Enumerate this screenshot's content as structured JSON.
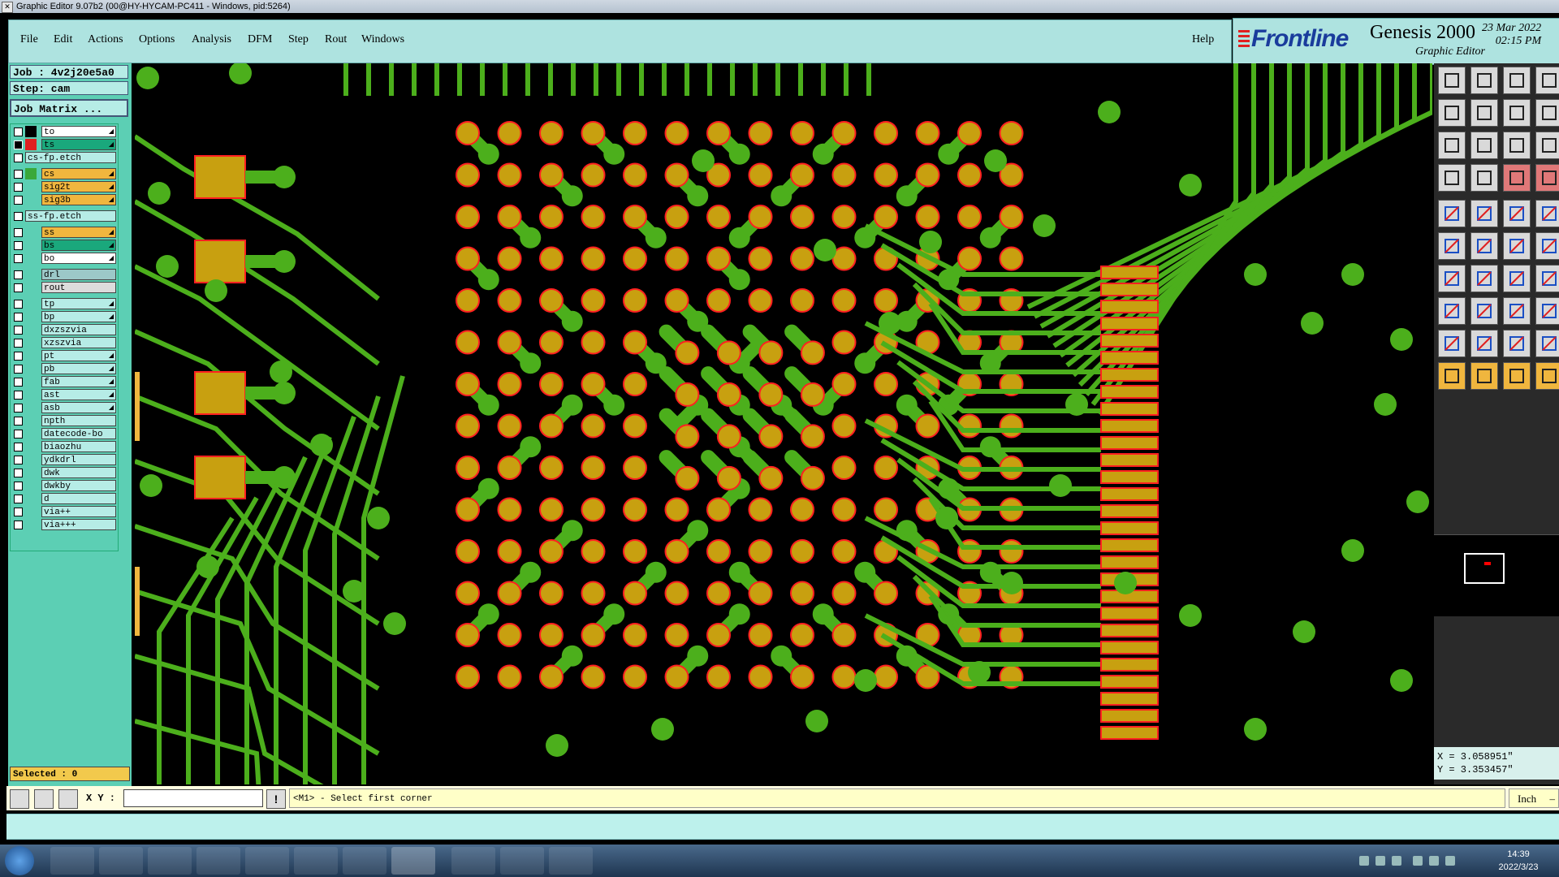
{
  "window": {
    "title": "Graphic Editor 9.07b2 (00@HY-HYCAM-PC411 - Windows, pid:5264)"
  },
  "menu": {
    "items": [
      "File",
      "Edit",
      "Actions",
      "Options",
      "Analysis",
      "DFM",
      "Step",
      "Rout",
      "Windows"
    ],
    "help": "Help"
  },
  "brand": {
    "logo": "Frontline",
    "product": "Genesis 2000",
    "subtitle": "Graphic Editor",
    "date": "23 Mar 2022",
    "time": "02:15 PM"
  },
  "job": {
    "job_label": "Job : 4v2j20e5a0",
    "step_label": "Step: cam",
    "matrix_button": "Job Matrix ..."
  },
  "layers": [
    {
      "name": "to",
      "color": "#ffffff",
      "swatch": "#000000",
      "arrow": true
    },
    {
      "name": "ts",
      "color": "#1aa87c",
      "swatch": "#e02020",
      "arrow": true,
      "active": true
    },
    {
      "name": "cs-fp.etch",
      "color": "#b6ece6",
      "swatch": "",
      "arrow": false,
      "wide": true
    },
    {
      "name": "cs",
      "color": "#f0b63e",
      "swatch": "#3aa83a",
      "arrow": true
    },
    {
      "name": "sig2t",
      "color": "#f0b63e",
      "swatch": "",
      "arrow": true
    },
    {
      "name": "sig3b",
      "color": "#f0b63e",
      "swatch": "",
      "arrow": true
    },
    {
      "name": "ss-fp.etch",
      "color": "#b6ece6",
      "swatch": "",
      "arrow": false,
      "wide": true
    },
    {
      "name": "ss",
      "color": "#f0b63e",
      "swatch": "",
      "arrow": true
    },
    {
      "name": "bs",
      "color": "#1aa87c",
      "swatch": "",
      "arrow": true
    },
    {
      "name": "bo",
      "color": "#ffffff",
      "swatch": "",
      "arrow": true
    },
    {
      "name": "drl",
      "color": "#9cc8c8",
      "swatch": "",
      "arrow": false
    },
    {
      "name": "rout",
      "color": "#dcdcdc",
      "swatch": "",
      "arrow": false
    },
    {
      "name": "tp",
      "color": "#b6ece6",
      "swatch": "",
      "arrow": true
    },
    {
      "name": "bp",
      "color": "#b6ece6",
      "swatch": "",
      "arrow": true
    },
    {
      "name": "dxzszvia",
      "color": "#b6ece6",
      "swatch": "",
      "arrow": false
    },
    {
      "name": "xzszvia",
      "color": "#b6ece6",
      "swatch": "",
      "arrow": false
    },
    {
      "name": "pt",
      "color": "#b6ece6",
      "swatch": "",
      "arrow": true
    },
    {
      "name": "pb",
      "color": "#b6ece6",
      "swatch": "",
      "arrow": true
    },
    {
      "name": "fab",
      "color": "#b6ece6",
      "swatch": "",
      "arrow": true
    },
    {
      "name": "ast",
      "color": "#b6ece6",
      "swatch": "",
      "arrow": true
    },
    {
      "name": "asb",
      "color": "#b6ece6",
      "swatch": "",
      "arrow": true
    },
    {
      "name": "npth",
      "color": "#b6ece6",
      "swatch": "",
      "arrow": false
    },
    {
      "name": "datecode-bo",
      "color": "#b6ece6",
      "swatch": "",
      "arrow": false
    },
    {
      "name": "biaozhu",
      "color": "#b6ece6",
      "swatch": "",
      "arrow": false
    },
    {
      "name": "ydkdrl",
      "color": "#b6ece6",
      "swatch": "",
      "arrow": false
    },
    {
      "name": "dwk",
      "color": "#b6ece6",
      "swatch": "",
      "arrow": false
    },
    {
      "name": "dwkby",
      "color": "#b6ece6",
      "swatch": "",
      "arrow": false
    },
    {
      "name": "d",
      "color": "#b6ece6",
      "swatch": "",
      "arrow": false
    },
    {
      "name": "via++",
      "color": "#b6ece6",
      "swatch": "",
      "arrow": false
    },
    {
      "name": "via+++",
      "color": "#b6ece6",
      "swatch": "",
      "arrow": false
    }
  ],
  "selection": {
    "label": "Selected : 0"
  },
  "coords": {
    "x": "X = 3.058951\"",
    "y": "Y = 3.353457\""
  },
  "command": {
    "xy_label": "X Y :",
    "xy_value": "",
    "warn": "!",
    "prompt": "<M1> - Select first corner",
    "unit": "Inch"
  },
  "taskbar": {
    "time": "14:39",
    "date": "2022/3/23"
  },
  "colors": {
    "trace": "#4caf1c",
    "pad": "#c8a010",
    "pad_outline": "#ff2020",
    "background": "#000000"
  }
}
